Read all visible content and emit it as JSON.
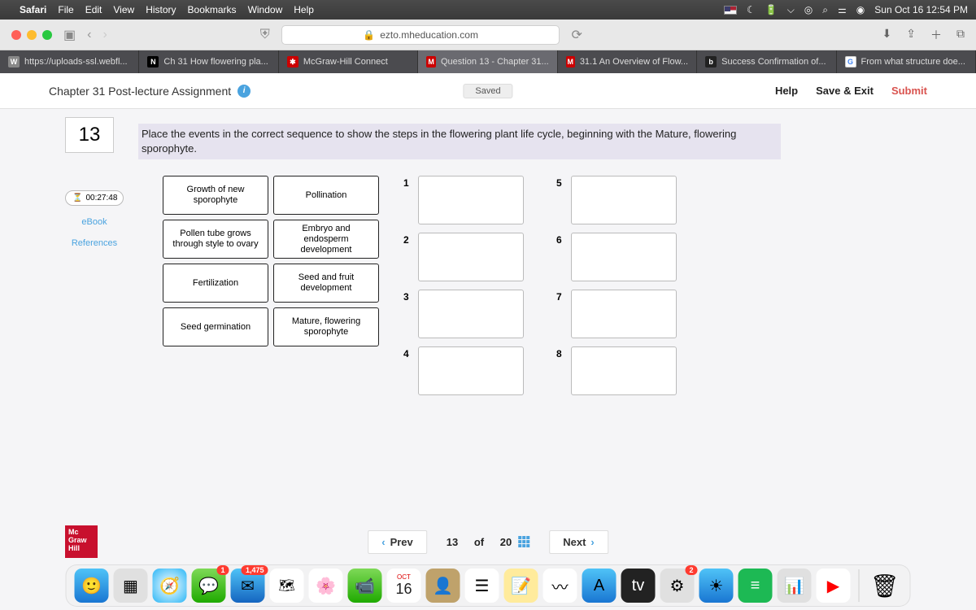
{
  "menubar": {
    "app": "Safari",
    "items": [
      "File",
      "Edit",
      "View",
      "History",
      "Bookmarks",
      "Window",
      "Help"
    ],
    "datetime": "Sun Oct 16  12:54 PM"
  },
  "browser": {
    "url": "ezto.mheducation.com",
    "tabs": [
      {
        "fav": "W",
        "label": "https://uploads-ssl.webfl..."
      },
      {
        "fav": "N",
        "label": "Ch 31 How flowering pla..."
      },
      {
        "fav": "MH",
        "label": "McGraw-Hill Connect"
      },
      {
        "fav": "M",
        "label": "Question 13 - Chapter 31...",
        "active": true
      },
      {
        "fav": "M",
        "label": "31.1 An Overview of Flow..."
      },
      {
        "fav": "b",
        "label": "Success Confirmation of..."
      },
      {
        "fav": "G",
        "label": "From what structure doe..."
      }
    ]
  },
  "assignment": {
    "title": "Chapter 31 Post-lecture Assignment",
    "saved": "Saved",
    "help": "Help",
    "save_exit": "Save & Exit",
    "submit": "Submit"
  },
  "question": {
    "number": "13",
    "prompt": "Place the events in the correct sequence to show the steps in the flowering plant life cycle, beginning with the Mature, flowering sporophyte.",
    "timer": "00:27:48",
    "links": {
      "ebook": "eBook",
      "references": "References"
    },
    "cards": [
      [
        "Growth of new sporophyte",
        "Pollination"
      ],
      [
        "Pollen tube grows through style to ovary",
        "Embryo and endosperm development"
      ],
      [
        "Fertilization",
        "Seed and fruit development"
      ],
      [
        "Seed germination",
        "Mature, flowering sporophyte"
      ]
    ],
    "slots_left": [
      "1",
      "2",
      "3",
      "4"
    ],
    "slots_right": [
      "5",
      "6",
      "7",
      "8"
    ]
  },
  "pager": {
    "prev": "Prev",
    "current": "13",
    "of": "of",
    "total": "20",
    "next": "Next"
  },
  "logo": {
    "l1": "Mc",
    "l2": "Graw",
    "l3": "Hill"
  },
  "dock": {
    "cal_month": "OCT",
    "cal_day": "16",
    "badge_msg": "1",
    "badge_mail": "1,475",
    "badge_sys": "2"
  }
}
